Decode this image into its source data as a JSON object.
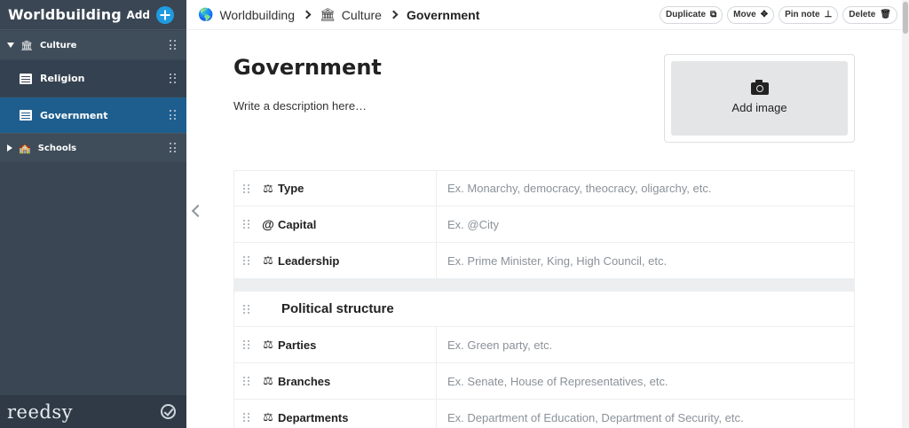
{
  "sidebar": {
    "title": "Worldbuilding",
    "add_label": "Add",
    "items": [
      {
        "label": "Culture",
        "icon": "institution-icon"
      },
      {
        "label": "Religion",
        "icon": "document-icon"
      },
      {
        "label": "Government",
        "icon": "document-icon",
        "selected": true
      },
      {
        "label": "Schools",
        "icon": "school-icon"
      }
    ],
    "footer_logo": "reedsy"
  },
  "breadcrumb": {
    "items": [
      {
        "label": "Worldbuilding",
        "icon": "globe-icon"
      },
      {
        "label": "Culture",
        "icon": "institution-icon"
      },
      {
        "label": "Government"
      }
    ]
  },
  "toolbar": {
    "duplicate": "Duplicate",
    "move": "Move",
    "pin_note": "Pin note",
    "delete": "Delete"
  },
  "page": {
    "title": "Government",
    "description": "Write a description here…",
    "add_image": "Add image"
  },
  "fields": [
    {
      "name": "Type",
      "placeholder": "Ex. Monarchy, democracy, theocracy, oligarchy, etc.",
      "icon": "scale-icon"
    },
    {
      "name": "Capital",
      "placeholder": "Ex. @City",
      "icon": "at-icon"
    },
    {
      "name": "Leadership",
      "placeholder": "Ex. Prime Minister, King, High Council, etc.",
      "icon": "scale-icon"
    }
  ],
  "section": {
    "title": "Political structure",
    "icon": "cube-icon",
    "fields": [
      {
        "name": "Parties",
        "placeholder": "Ex. Green party, etc.",
        "icon": "scale-icon"
      },
      {
        "name": "Branches",
        "placeholder": "Ex. Senate, House of Representatives, etc.",
        "icon": "scale-icon"
      },
      {
        "name": "Departments",
        "placeholder": "Ex. Department of Education, Department of Security, etc.",
        "icon": "scale-icon"
      }
    ]
  },
  "colors": {
    "sidebar_bg": "#3a4654",
    "selected_bg": "#1e5e8e",
    "accent": "#1f9be0"
  }
}
